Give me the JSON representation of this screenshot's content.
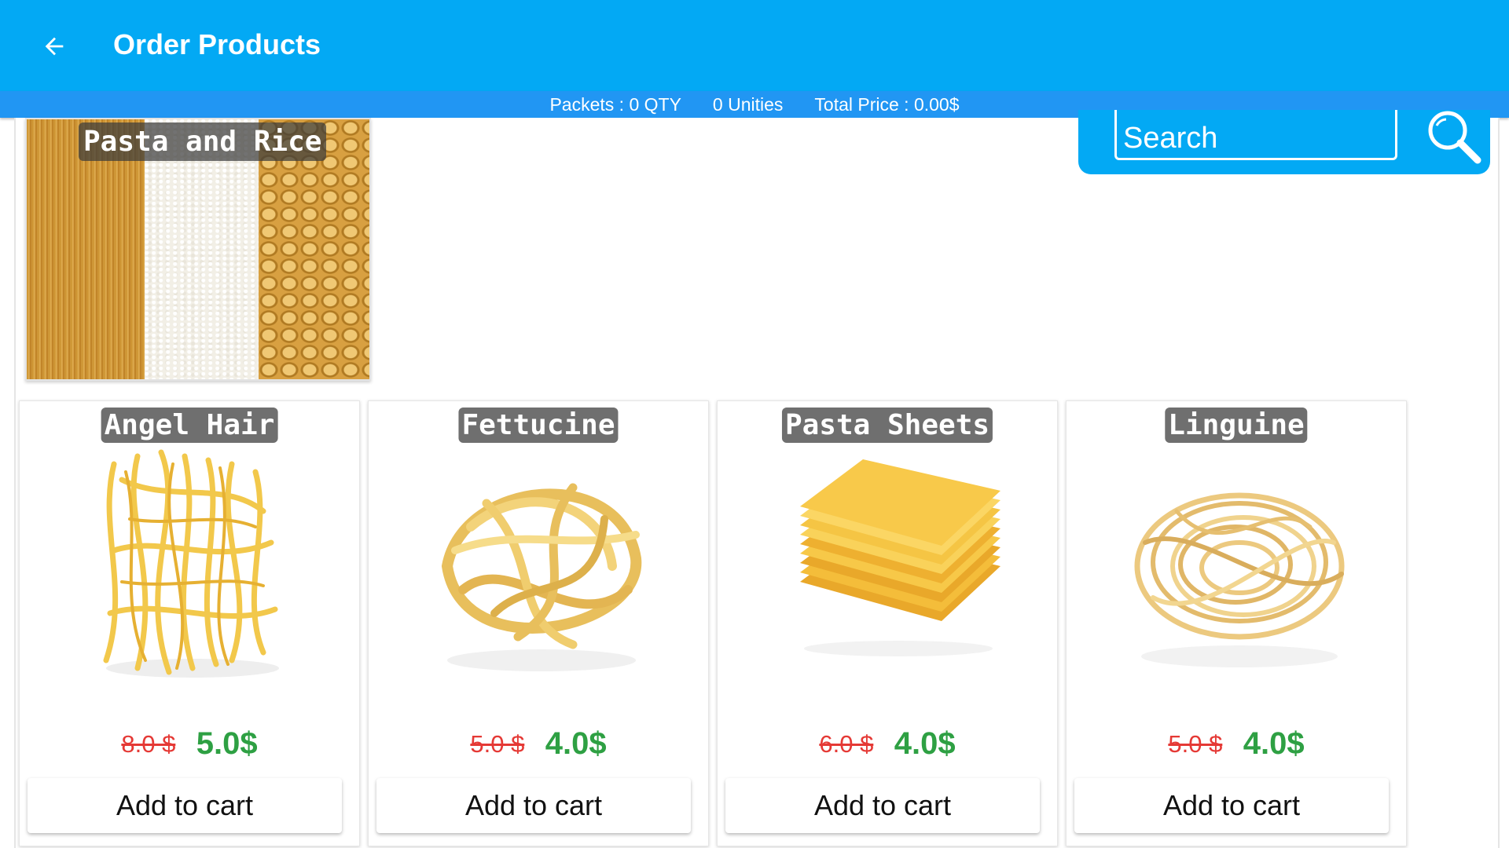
{
  "header": {
    "title": "Order Products",
    "back_icon": "arrow-left-icon"
  },
  "status": {
    "packets": "Packets : 0 QTY",
    "unities": "0 Unities",
    "total": "Total Price : 0.00$"
  },
  "category": {
    "label": "Pasta and Rice"
  },
  "search": {
    "placeholder": "Search",
    "icon": "search-icon"
  },
  "colors": {
    "appbar": "#03A9F4",
    "statusbar": "#2196F3",
    "old_price": "#e53935",
    "new_price": "#2ea043"
  },
  "products": [
    {
      "name": "Angel Hair",
      "old_price": "8.0 $",
      "new_price": "5.0$",
      "button": "Add to cart"
    },
    {
      "name": "Fettucine",
      "old_price": "5.0 $",
      "new_price": "4.0$",
      "button": "Add to cart"
    },
    {
      "name": "Pasta Sheets",
      "old_price": "6.0 $",
      "new_price": "4.0$",
      "button": "Add to cart"
    },
    {
      "name": "Linguine",
      "old_price": "5.0 $",
      "new_price": "4.0$",
      "button": "Add to cart"
    }
  ]
}
